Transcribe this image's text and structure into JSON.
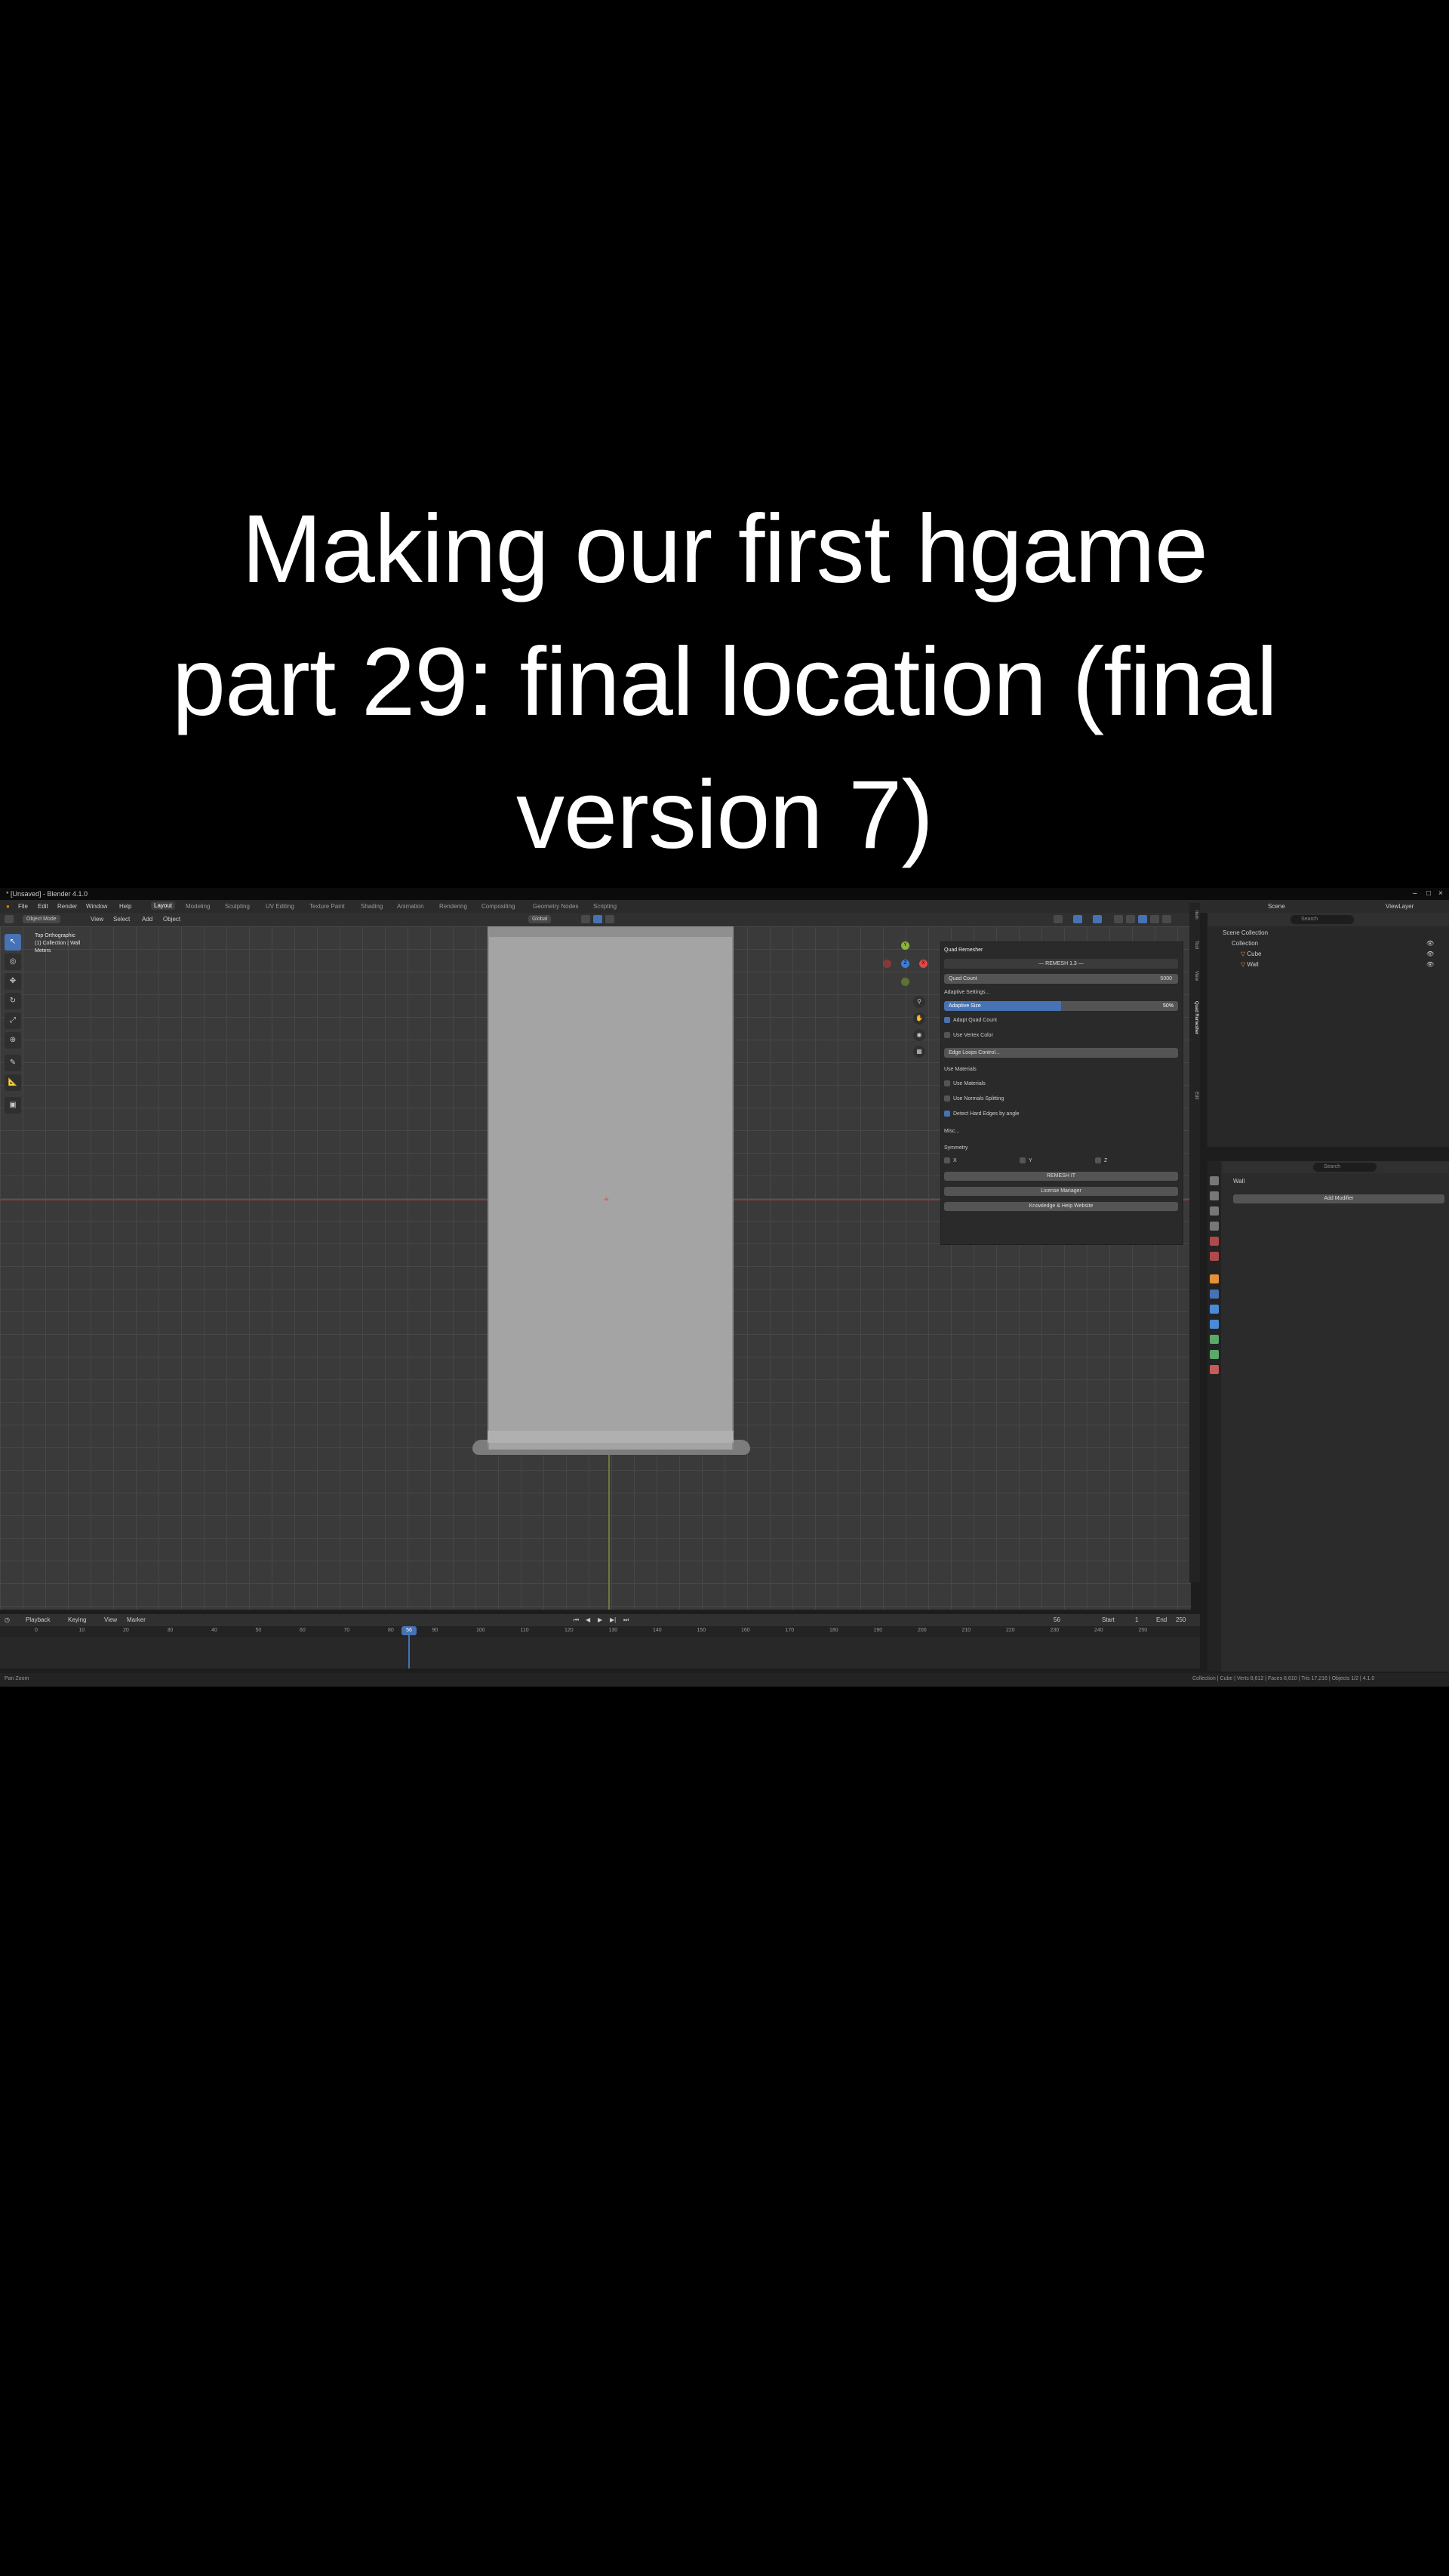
{
  "caption": {
    "line1": "Making our first hgame",
    "line2": "part 29: final location (final",
    "line3": "version 7)"
  },
  "app": {
    "title": "* [Unsaved] - Blender 4.1.0",
    "menu": [
      "File",
      "Edit",
      "Render",
      "Window",
      "Help"
    ],
    "workspaces": [
      "Layout",
      "Modeling",
      "Sculpting",
      "UV Editing",
      "Texture Paint",
      "Shading",
      "Animation",
      "Rendering",
      "Compositing",
      "Geometry Nodes",
      "Scripting"
    ],
    "active_workspace": "Layout",
    "header": {
      "mode": "Object Mode",
      "view": "View",
      "select": "Select",
      "add": "Add",
      "object": "Object",
      "orientation": "Global",
      "options": "Options",
      "scene": "Scene",
      "view_layer": "ViewLayer"
    },
    "viewport": {
      "info_line1": "Top Orthographic",
      "info_line2": "(1) Collection | Wall",
      "info_line3": "Meters",
      "tools": [
        "cursor-icon",
        "select-icon",
        "move-icon",
        "rotate-icon",
        "scale-icon",
        "transform-icon",
        "annotate-icon",
        "measure-icon",
        "add-cube-icon"
      ]
    },
    "npanel": {
      "header": "Quad Remesher",
      "version": "— REMESH 1.3 —",
      "quad_count_label": "Quad Count",
      "quad_count_value": "5000",
      "adaptive_label": "Adaptive Settings...",
      "progress_label": "Adaptive Size",
      "progress_value": "50%",
      "progress_fraction": 0.5,
      "check_adapt_quad_count": "Adapt Quad Count",
      "check_use_vertex_color": "Use Vertex Color",
      "use_materials_label": "Use Materials",
      "edge_loops_label": "Edge Loops Control...",
      "check_use_materials": "Use Materials",
      "check_use_normals": "Use Normals Splitting",
      "check_detect_hard_edges": "Detect Hard Edges by angle",
      "misc_label": "Misc...",
      "symmetry_label": "Symmetry",
      "sym_x": "X",
      "sym_y": "Y",
      "sym_z": "Z",
      "btn_remesh": "REMESH IT",
      "btn_license": "License Manager",
      "btn_docs": "Knowledge & Help Website"
    },
    "timeline": {
      "playback": "Playback",
      "keying": "Keying",
      "view": "View",
      "marker": "Marker",
      "current_frame": "56",
      "start_label": "Start",
      "start": "1",
      "end_label": "End",
      "end": "250",
      "ticks": [
        "0",
        "10",
        "20",
        "30",
        "40",
        "50",
        "60",
        "70",
        "80",
        "90",
        "100",
        "110",
        "120",
        "130",
        "140",
        "150",
        "160",
        "170",
        "180",
        "190",
        "200",
        "210",
        "220",
        "230",
        "240",
        "250"
      ]
    },
    "outliner": {
      "search_placeholder": "Search",
      "scene_collection": "Scene Collection",
      "collection": "Collection",
      "items": [
        "Cube",
        "Wall"
      ]
    },
    "properties": {
      "object_name": "Wall",
      "add_modifier": "Add Modifier"
    },
    "status": {
      "left": "Pan   Zoom",
      "right": "Collection | Cube | Verts 8,612 | Faces 8,610 | Tris 17,216 | Objects 1/2 | 4.1.0"
    }
  }
}
